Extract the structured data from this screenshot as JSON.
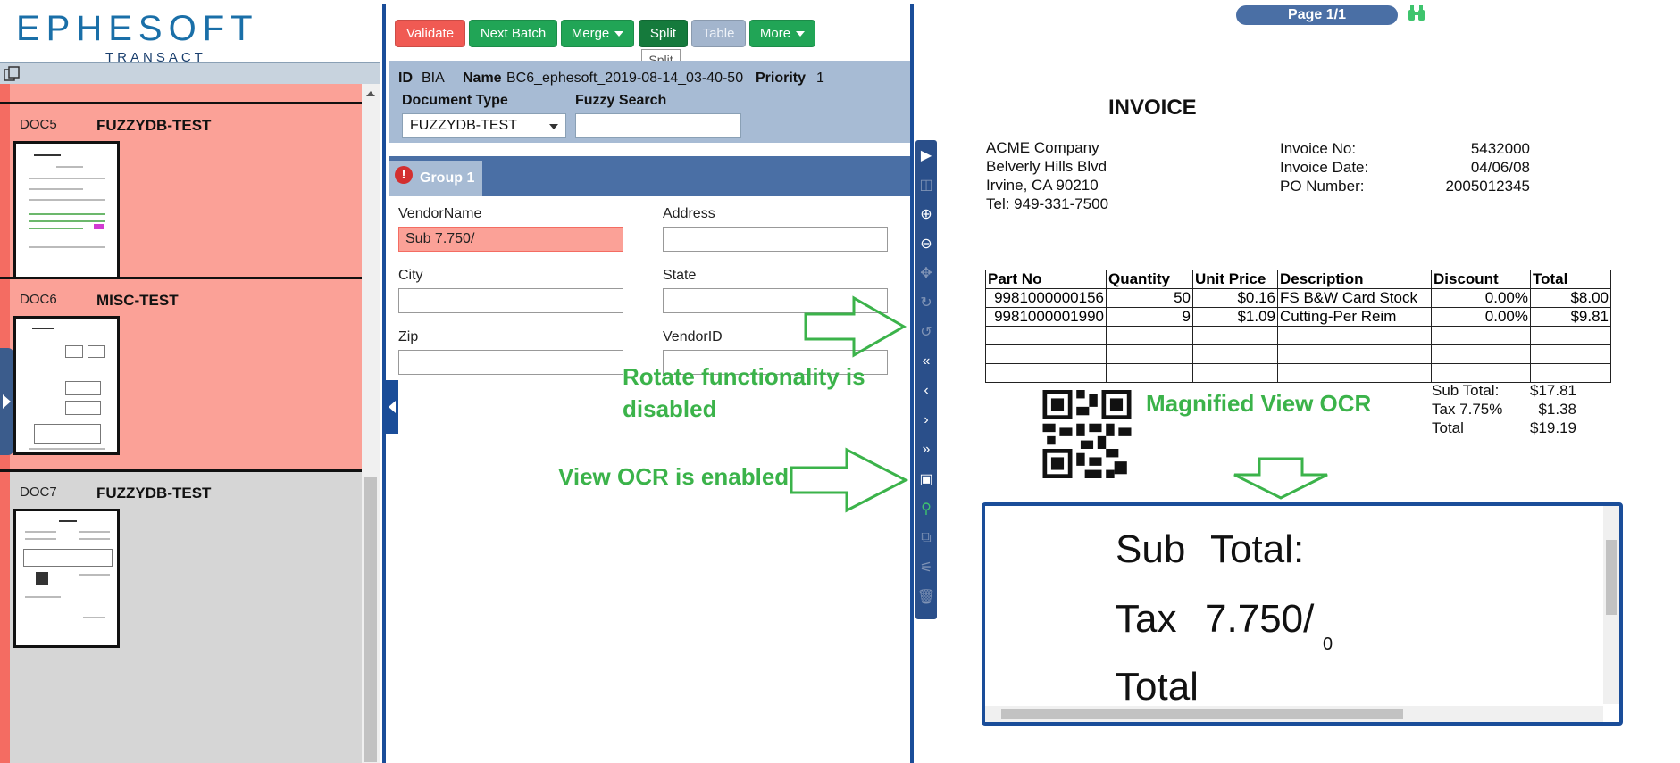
{
  "logo": {
    "main": "EPHESOFT",
    "sub": "TRANSACT"
  },
  "documents": [
    {
      "id": "DOC5",
      "type": "FUZZYDB-TEST",
      "status": "error"
    },
    {
      "id": "DOC6",
      "type": "MISC-TEST",
      "status": "error"
    },
    {
      "id": "DOC7",
      "type": "FUZZYDB-TEST",
      "status": "ok"
    }
  ],
  "toolbar": {
    "validate": "Validate",
    "next_batch": "Next Batch",
    "merge": "Merge",
    "split": "Split",
    "table": "Table",
    "more": "More",
    "tooltip": "Split"
  },
  "batch": {
    "id_label": "ID",
    "id_value": "BIA",
    "name_label": "Name",
    "name_value": "BC6_ephesoft_2019-08-14_03-40-50",
    "priority_label": "Priority",
    "priority_value": "1",
    "doc_type_label": "Document Type",
    "doc_type_value": "FUZZYDB-TEST",
    "fuzzy_label": "Fuzzy Search",
    "fuzzy_value": ""
  },
  "group": {
    "label": "Group 1",
    "error_icon": "!"
  },
  "fields": {
    "vendor_name": {
      "label": "VendorName",
      "value": "Sub 7.750/"
    },
    "address": {
      "label": "Address",
      "value": ""
    },
    "city": {
      "label": "City",
      "value": ""
    },
    "state": {
      "label": "State",
      "value": ""
    },
    "zip": {
      "label": "Zip",
      "value": ""
    },
    "vendor_id": {
      "label": "VendorID",
      "value": ""
    }
  },
  "viewer": {
    "page_indicator": "Page 1/1",
    "magnified": {
      "line1a": "Sub",
      "line1b": "Total:",
      "line2a": "Tax",
      "line2b": "7.750/",
      "line2c": "0",
      "line3": "Total"
    }
  },
  "invoice": {
    "title": "INVOICE",
    "company": [
      "ACME Company",
      "Belverly Hills Blvd",
      "Irvine, CA 90210",
      "Tel: 949-331-7500"
    ],
    "meta_labels": [
      "Invoice No:",
      "Invoice Date:",
      "PO Number:"
    ],
    "meta_values": [
      "5432000",
      "04/06/08",
      "2005012345"
    ],
    "table_headers": [
      "Part No",
      "Quantity",
      "Unit Price",
      "Description",
      "Discount",
      "Total"
    ],
    "rows": [
      [
        "9981000000156",
        "50",
        "$0.16",
        "FS B&W Card Stock",
        "0.00%",
        "$8.00"
      ],
      [
        "9981000001990",
        "9",
        "$1.09",
        "Cutting-Per Reim",
        "0.00%",
        "$9.81"
      ]
    ],
    "totals_labels": [
      "Sub Total:",
      "Tax 7.75%",
      "Total"
    ],
    "totals_values": [
      "$17.81",
      "$1.38",
      "$19.19"
    ]
  },
  "annotations": {
    "rotate": "Rotate functionality is disabled",
    "view_ocr": "View OCR is enabled",
    "magnified": "Magnified View OCR"
  },
  "colors": {
    "error": "#fba197",
    "accent_blue": "#1a4d99",
    "green": "#3bb34a"
  }
}
